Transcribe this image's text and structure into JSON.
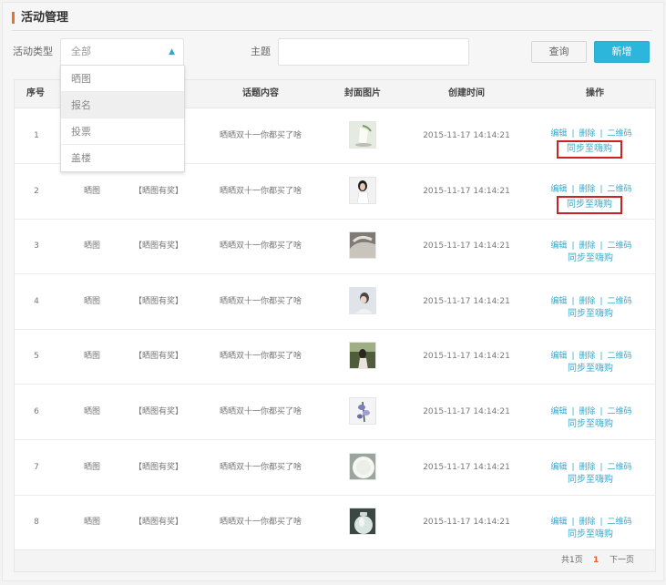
{
  "page": {
    "title": "活动管理"
  },
  "filters": {
    "type_label": "活动类型",
    "type_value": "全部",
    "theme_label": "主题",
    "theme_value": ""
  },
  "buttons": {
    "query": "查询",
    "add": "新增"
  },
  "dropdown": {
    "options": [
      "晒图",
      "报名",
      "投票",
      "盖楼"
    ],
    "highlighted": "报名"
  },
  "table": {
    "headers": [
      "序号",
      "话题内容",
      "封面图片",
      "创建时间",
      "操作"
    ],
    "actions": {
      "edit": "编辑",
      "delete": "删除",
      "qrcode": "二维码",
      "sep": "|",
      "sync": "同步至嗨购"
    },
    "rows": [
      {
        "no": "1",
        "type": "",
        "tag": "",
        "content": "晒晒双十一你都买了啥",
        "time": "2015-11-17  14:14:21",
        "cover": "vase-photo",
        "sync_boxed": true
      },
      {
        "no": "2",
        "type": "晒图",
        "tag": "【晒图有奖】",
        "content": "晒晒双十一你都买了啥",
        "time": "2015-11-17  14:14:21",
        "cover": "woman-photo",
        "sync_boxed": true
      },
      {
        "no": "3",
        "type": "晒图",
        "tag": "【晒图有奖】",
        "content": "晒晒双十一你都买了啥",
        "time": "2015-11-17  14:14:21",
        "cover": "fabric-photo",
        "sync_boxed": false
      },
      {
        "no": "4",
        "type": "晒图",
        "tag": "【晒图有奖】",
        "content": "晒晒双十一你都买了啥",
        "time": "2015-11-17  14:14:21",
        "cover": "portrait-photo",
        "sync_boxed": false
      },
      {
        "no": "5",
        "type": "晒图",
        "tag": "【晒图有奖】",
        "content": "晒晒双十一你都买了啥",
        "time": "2015-11-17  14:14:21",
        "cover": "garden-photo",
        "sync_boxed": false
      },
      {
        "no": "6",
        "type": "晒图",
        "tag": "【晒图有奖】",
        "content": "晒晒双十一你都买了啥",
        "time": "2015-11-17  14:14:21",
        "cover": "flower-photo",
        "sync_boxed": false
      },
      {
        "no": "7",
        "type": "晒图",
        "tag": "【晒图有奖】",
        "content": "晒晒双十一你都买了啥",
        "time": "2015-11-17  14:14:21",
        "cover": "plate-photo",
        "sync_boxed": false
      },
      {
        "no": "8",
        "type": "晒图",
        "tag": "【晒图有奖】",
        "content": "晒晒双十一你都买了啥",
        "time": "2015-11-17  14:14:21",
        "cover": "jar-photo",
        "sync_boxed": false
      }
    ]
  },
  "pagination": {
    "total": "共1页",
    "current": "1",
    "next": "下一页"
  },
  "colors": {
    "accent": "#2cb6db",
    "link": "#3aa8c9",
    "highlight_box": "#cc2222",
    "title_bar": "#e5722f"
  }
}
